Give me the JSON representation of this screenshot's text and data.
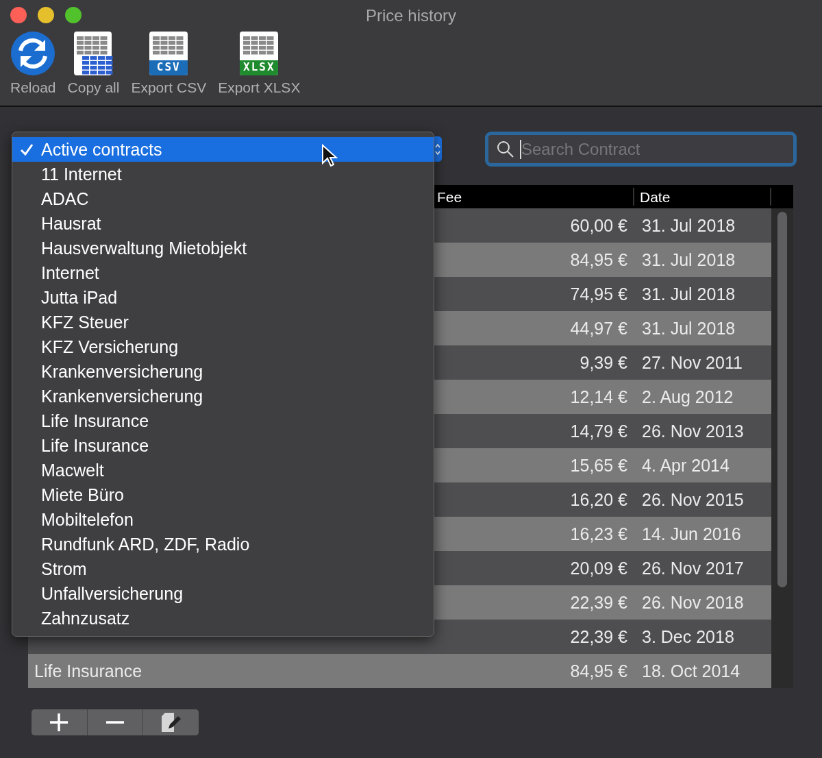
{
  "window": {
    "title": "Price history"
  },
  "toolbar": [
    {
      "kind": "reload",
      "label": "Reload"
    },
    {
      "kind": "copy",
      "label": "Copy all"
    },
    {
      "kind": "csv",
      "label": "Export CSV",
      "badge": "CSV"
    },
    {
      "kind": "xlsx",
      "label": "Export XLSX",
      "badge": "XLSX"
    }
  ],
  "filter_menu": {
    "items": [
      {
        "label": "Active contracts",
        "selected": true
      },
      {
        "label": "11 Internet",
        "selected": false
      },
      {
        "label": "ADAC",
        "selected": false
      },
      {
        "label": "Hausrat",
        "selected": false
      },
      {
        "label": "Hausverwaltung Mietobjekt",
        "selected": false
      },
      {
        "label": "Internet",
        "selected": false
      },
      {
        "label": "Jutta iPad",
        "selected": false
      },
      {
        "label": "KFZ Steuer",
        "selected": false
      },
      {
        "label": "KFZ Versicherung",
        "selected": false
      },
      {
        "label": "Krankenversicherung",
        "selected": false
      },
      {
        "label": "Krankenversicherung",
        "selected": false
      },
      {
        "label": "Life Insurance",
        "selected": false
      },
      {
        "label": "Life Insurance",
        "selected": false
      },
      {
        "label": "Macwelt",
        "selected": false
      },
      {
        "label": "Miete Büro",
        "selected": false
      },
      {
        "label": "Mobiltelefon",
        "selected": false
      },
      {
        "label": "Rundfunk ARD, ZDF, Radio",
        "selected": false
      },
      {
        "label": "Strom",
        "selected": false
      },
      {
        "label": "Unfallversicherung",
        "selected": false
      },
      {
        "label": "Zahnzusatz",
        "selected": false
      }
    ]
  },
  "search": {
    "placeholder": "Search Contract"
  },
  "table": {
    "columns": [
      "Fee",
      "Date"
    ],
    "rows": [
      {
        "fee": "60,00 €",
        "date": "31. Jul 2018"
      },
      {
        "fee": "84,95 €",
        "date": "31. Jul 2018"
      },
      {
        "fee": "74,95 €",
        "date": "31. Jul 2018"
      },
      {
        "fee": "44,97 €",
        "date": "31. Jul 2018"
      },
      {
        "fee": "9,39 €",
        "date": "27. Nov 2011"
      },
      {
        "fee": "12,14 €",
        "date": "2. Aug 2012"
      },
      {
        "fee": "14,79 €",
        "date": "26. Nov 2013"
      },
      {
        "fee": "15,65 €",
        "date": "4. Apr 2014"
      },
      {
        "fee": "16,20 €",
        "date": "26. Nov 2015"
      },
      {
        "fee": "16,23 €",
        "date": "14. Jun 2016"
      },
      {
        "fee": "20,09 €",
        "date": "26. Nov 2017"
      },
      {
        "fee": "22,39 €",
        "date": "26. Nov 2018"
      },
      {
        "fee": "22,39 €",
        "date": "3. Dec 2018"
      },
      {
        "name": "Life Insurance",
        "fee": "84,95 €",
        "date": "18. Oct 2014"
      }
    ]
  },
  "bottom_buttons": [
    {
      "kind": "add"
    },
    {
      "kind": "remove"
    },
    {
      "kind": "edit"
    }
  ]
}
